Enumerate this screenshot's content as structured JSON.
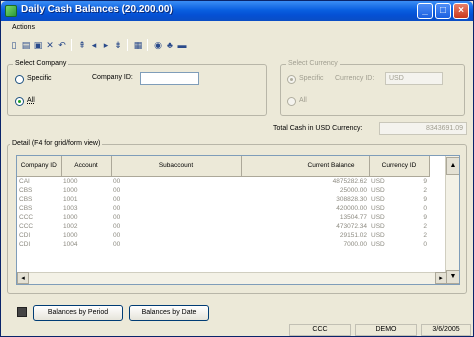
{
  "window": {
    "title": "Daily Cash Balances (20.200.00)"
  },
  "menu": {
    "actions": "Actions"
  },
  "select_company": {
    "title": "Select Company",
    "specific": "Specific",
    "company_id_label": "Company ID:",
    "company_id_value": "",
    "all": "All"
  },
  "select_currency": {
    "title": "Select Currency",
    "specific": "Specific",
    "currency_id_label": "Currency ID:",
    "currency_id_value": "USD",
    "all": "All"
  },
  "total": {
    "label": "Total Cash in USD Currency:",
    "value": "8343691.09"
  },
  "detail": {
    "title": "Detail (F4 for grid/form view)",
    "columns": [
      "Company ID",
      "Account",
      "Subaccount",
      "Current Balance",
      "Currency ID"
    ],
    "rows": [
      [
        "CAI",
        "1000",
        "00",
        "4875282.62",
        "USD",
        "9"
      ],
      [
        "CBS",
        "1000",
        "00",
        "25000.00",
        "USD",
        "2"
      ],
      [
        "CBS",
        "1001",
        "00",
        "308828.30",
        "USD",
        "9"
      ],
      [
        "CBS",
        "1003",
        "00",
        "420000.00",
        "USD",
        "0"
      ],
      [
        "CCC",
        "1000",
        "00",
        "13504.77",
        "USD",
        "9"
      ],
      [
        "CCC",
        "1002",
        "00",
        "473072.34",
        "USD",
        "2"
      ],
      [
        "CDI",
        "1000",
        "00",
        "29151.02",
        "USD",
        "2"
      ],
      [
        "CDI",
        "1004",
        "00",
        "7000.00",
        "USD",
        "0"
      ]
    ]
  },
  "buttons": {
    "by_period": "Balances by Period",
    "by_date": "Balances by Date"
  },
  "status": {
    "company": "CCC",
    "database": "DEMO",
    "date": "3/6/2005"
  },
  "colors": {
    "titlebar": "#0a5fe0",
    "face": "#ece9d8",
    "disabled_text": "#8c8a80"
  }
}
